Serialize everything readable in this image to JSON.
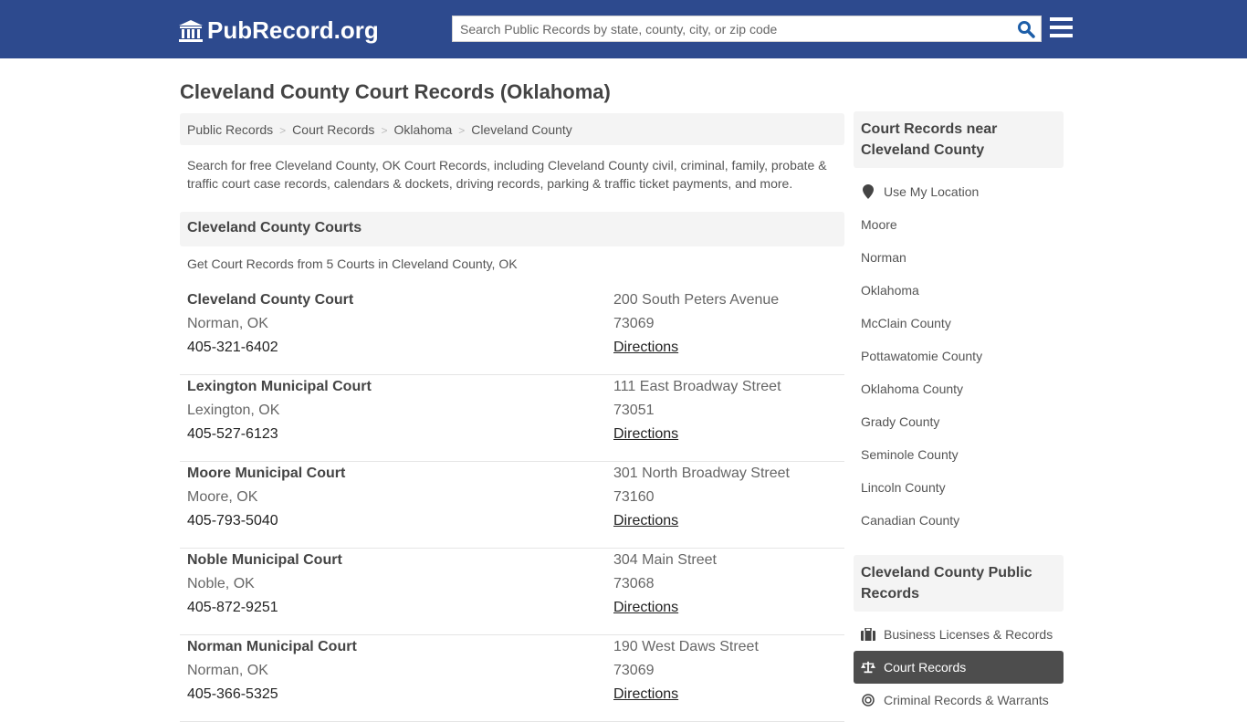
{
  "header": {
    "logo_text": "PubRecord.org",
    "search_placeholder": "Search Public Records by state, county, city, or zip code",
    "search_value": "",
    "brand_color": "#2d4a8e"
  },
  "page": {
    "title": "Cleveland County Court Records (Oklahoma)",
    "breadcrumb": [
      "Public Records",
      "Court Records",
      "Oklahoma",
      "Cleveland County"
    ],
    "intro": "Search for free Cleveland County, OK Court Records, including Cleveland County civil, criminal, family, probate & traffic court case records, calendars & dockets, driving records, parking & traffic ticket payments, and more."
  },
  "courts_section": {
    "heading": "Cleveland County Courts",
    "count_text": "Get Court Records from 5 Courts in Cleveland County, OK",
    "courts": [
      {
        "name": "Cleveland County Court",
        "city": "Norman, OK",
        "phone": "405-321-6402",
        "address": "200 South Peters Avenue",
        "zip": "73069",
        "directions": "Directions"
      },
      {
        "name": "Lexington Municipal Court",
        "city": "Lexington, OK",
        "phone": "405-527-6123",
        "address": "111 East Broadway Street",
        "zip": "73051",
        "directions": "Directions"
      },
      {
        "name": "Moore Municipal Court",
        "city": "Moore, OK",
        "phone": "405-793-5040",
        "address": "301 North Broadway Street",
        "zip": "73160",
        "directions": "Directions"
      },
      {
        "name": "Noble Municipal Court",
        "city": "Noble, OK",
        "phone": "405-872-9251",
        "address": "304 Main Street",
        "zip": "73068",
        "directions": "Directions"
      },
      {
        "name": "Norman Municipal Court",
        "city": "Norman, OK",
        "phone": "405-366-5325",
        "address": "190 West Daws Street",
        "zip": "73069",
        "directions": "Directions"
      }
    ]
  },
  "sidebar": {
    "nearby_heading": "Court Records near Cleveland County",
    "use_location": "Use My Location",
    "nearby": [
      "Moore",
      "Norman",
      "Oklahoma",
      "McClain County",
      "Pottawatomie County",
      "Oklahoma County",
      "Grady County",
      "Seminole County",
      "Lincoln County",
      "Canadian County"
    ],
    "public_heading": "Cleveland County Public Records",
    "public_items": [
      {
        "label": "Business Licenses & Records",
        "icon": "briefcase-icon",
        "active": false
      },
      {
        "label": "Court Records",
        "icon": "scale-icon",
        "active": true
      },
      {
        "label": "Criminal Records & Warrants",
        "icon": "fingerprint-icon",
        "active": false
      }
    ]
  }
}
